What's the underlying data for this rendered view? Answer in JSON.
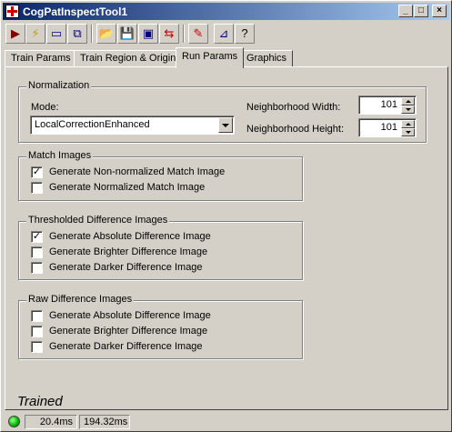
{
  "window": {
    "title": "CogPatInspectTool1",
    "minimize_glyph": "_",
    "maximize_glyph": "□",
    "close_glyph": "×"
  },
  "toolbar": {
    "buttons": [
      {
        "name": "run-icon",
        "glyph": "▶",
        "color": "#800000"
      },
      {
        "name": "wand-icon",
        "glyph": "⚡",
        "color": "#c0a000"
      },
      {
        "name": "image-source-icon",
        "glyph": "▭",
        "color": "#000080"
      },
      {
        "name": "switch-window-icon",
        "glyph": "⧉",
        "color": "#000080"
      },
      {
        "name": "open-folder-icon",
        "glyph": "📂",
        "color": "#c08000"
      },
      {
        "name": "save-icon",
        "glyph": "💾",
        "color": "#000080"
      },
      {
        "name": "save-as-icon",
        "glyph": "▣",
        "color": "#000080"
      },
      {
        "name": "reset-icon",
        "glyph": "⇆",
        "color": "#c00000"
      },
      {
        "name": "train-icon",
        "glyph": "✎",
        "color": "#c00000"
      },
      {
        "name": "display-icon",
        "glyph": "⊿",
        "color": "#000080"
      },
      {
        "name": "help-icon",
        "glyph": "?",
        "color": "#000000"
      }
    ]
  },
  "tabs": [
    {
      "label": "Train Params",
      "active": false
    },
    {
      "label": "Train Region & Origin",
      "active": false
    },
    {
      "label": "Run Params",
      "active": true
    },
    {
      "label": "Graphics",
      "active": false
    }
  ],
  "normalization": {
    "legend": "Normalization",
    "mode_label": "Mode:",
    "mode_value": "LocalCorrectionEnhanced",
    "neighborhood_width_label": "Neighborhood Width:",
    "neighborhood_width_value": "101",
    "neighborhood_height_label": "Neighborhood Height:",
    "neighborhood_height_value": "101"
  },
  "match_images": {
    "legend": "Match Images",
    "items": [
      {
        "label": "Generate Non-normalized Match Image",
        "checked": true
      },
      {
        "label": "Generate Normalized Match Image",
        "checked": false
      }
    ]
  },
  "thresholded_diff": {
    "legend": "Thresholded Difference Images",
    "items": [
      {
        "label": "Generate Absolute Difference Image",
        "checked": true
      },
      {
        "label": "Generate Brighter Difference Image",
        "checked": false
      },
      {
        "label": "Generate Darker Difference Image",
        "checked": false
      }
    ]
  },
  "raw_diff": {
    "legend": "Raw Difference Images",
    "items": [
      {
        "label": "Generate Absolute Difference Image",
        "checked": false
      },
      {
        "label": "Generate Brighter Difference Image",
        "checked": false
      },
      {
        "label": "Generate Darker Difference Image",
        "checked": false
      }
    ]
  },
  "status": {
    "state_text": "Trained",
    "time_1": "20.4ms",
    "time_2": "194.32ms",
    "led_color": "#00c000"
  }
}
